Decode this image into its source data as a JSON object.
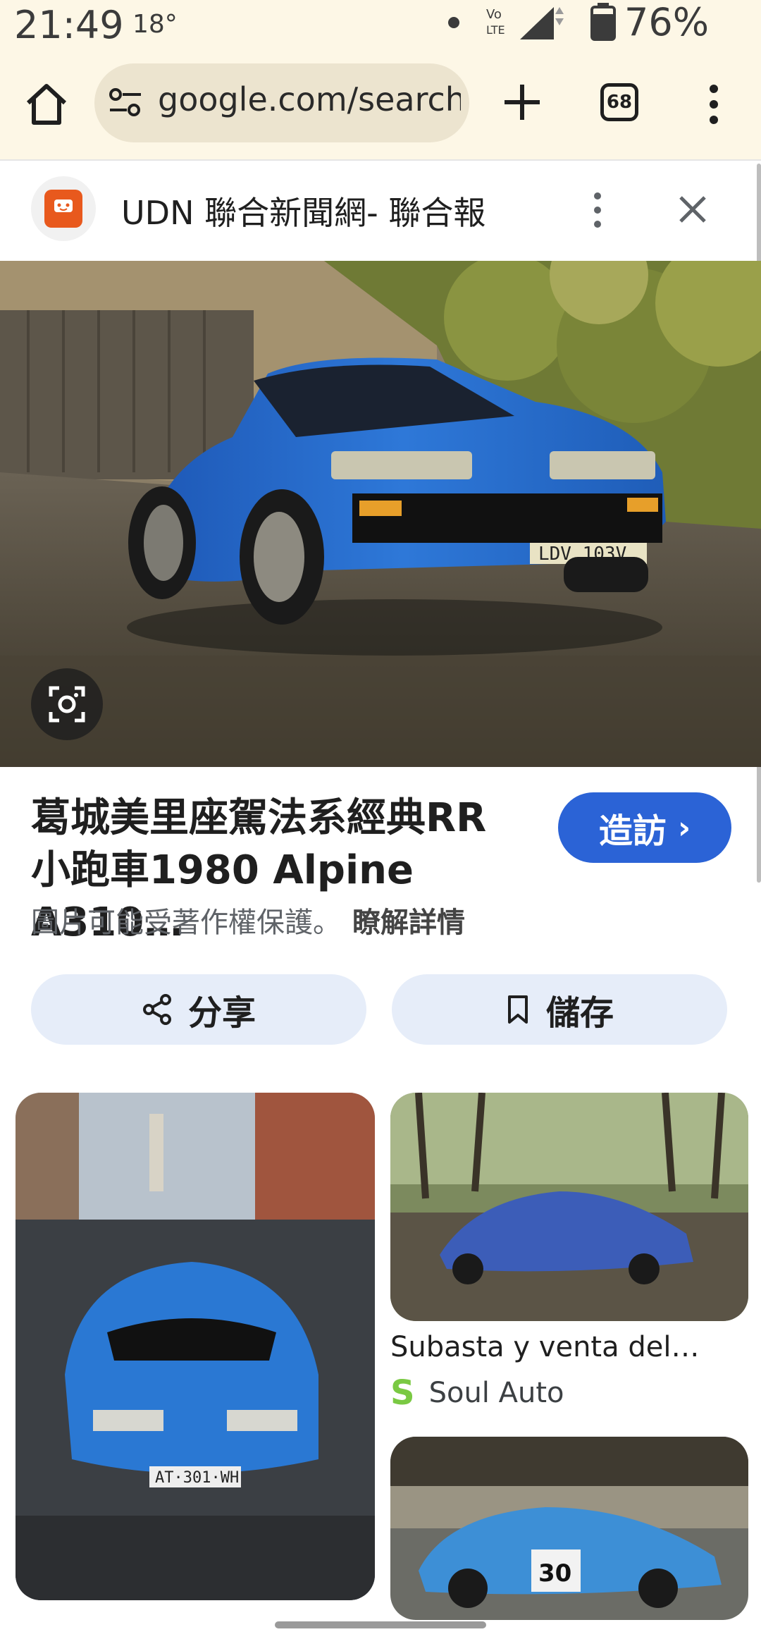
{
  "status_bar": {
    "time": "21:49",
    "temperature": "18°",
    "battery_percent": "76%",
    "icons": [
      "dot-icon",
      "volte-icon",
      "signal-icon",
      "battery-icon"
    ]
  },
  "browser": {
    "url": "google.com/search?",
    "tab_count": "68",
    "icons": [
      "home-icon",
      "tune-icon",
      "plus-icon",
      "tabs-icon",
      "more-vert-icon"
    ]
  },
  "source": {
    "name": "UDN 聯合新聞網- 聯合報",
    "icons": [
      "udn-logo-icon",
      "more-vert-icon",
      "close-icon"
    ]
  },
  "result": {
    "title_line1": "葛城美里座駕法系經典RR",
    "title_line2": "小跑車1980 Alpine A310…",
    "visit_label": "造訪",
    "copyright_notice": "圖片可能受著作權保護。",
    "learn_more_label": "瞭解詳情"
  },
  "actions": {
    "share_label": "分享",
    "save_label": "儲存"
  },
  "related": [
    {
      "title": "Subasta y venta del…",
      "source": "Soul Auto",
      "source_logo": "S"
    }
  ],
  "colors": {
    "toolbar_bg": "#fdf7e6",
    "accent_blue": "#2b63d6",
    "action_bg": "#e6edf9",
    "udn_orange": "#e8591d",
    "soul_auto_green": "#7ac943"
  }
}
